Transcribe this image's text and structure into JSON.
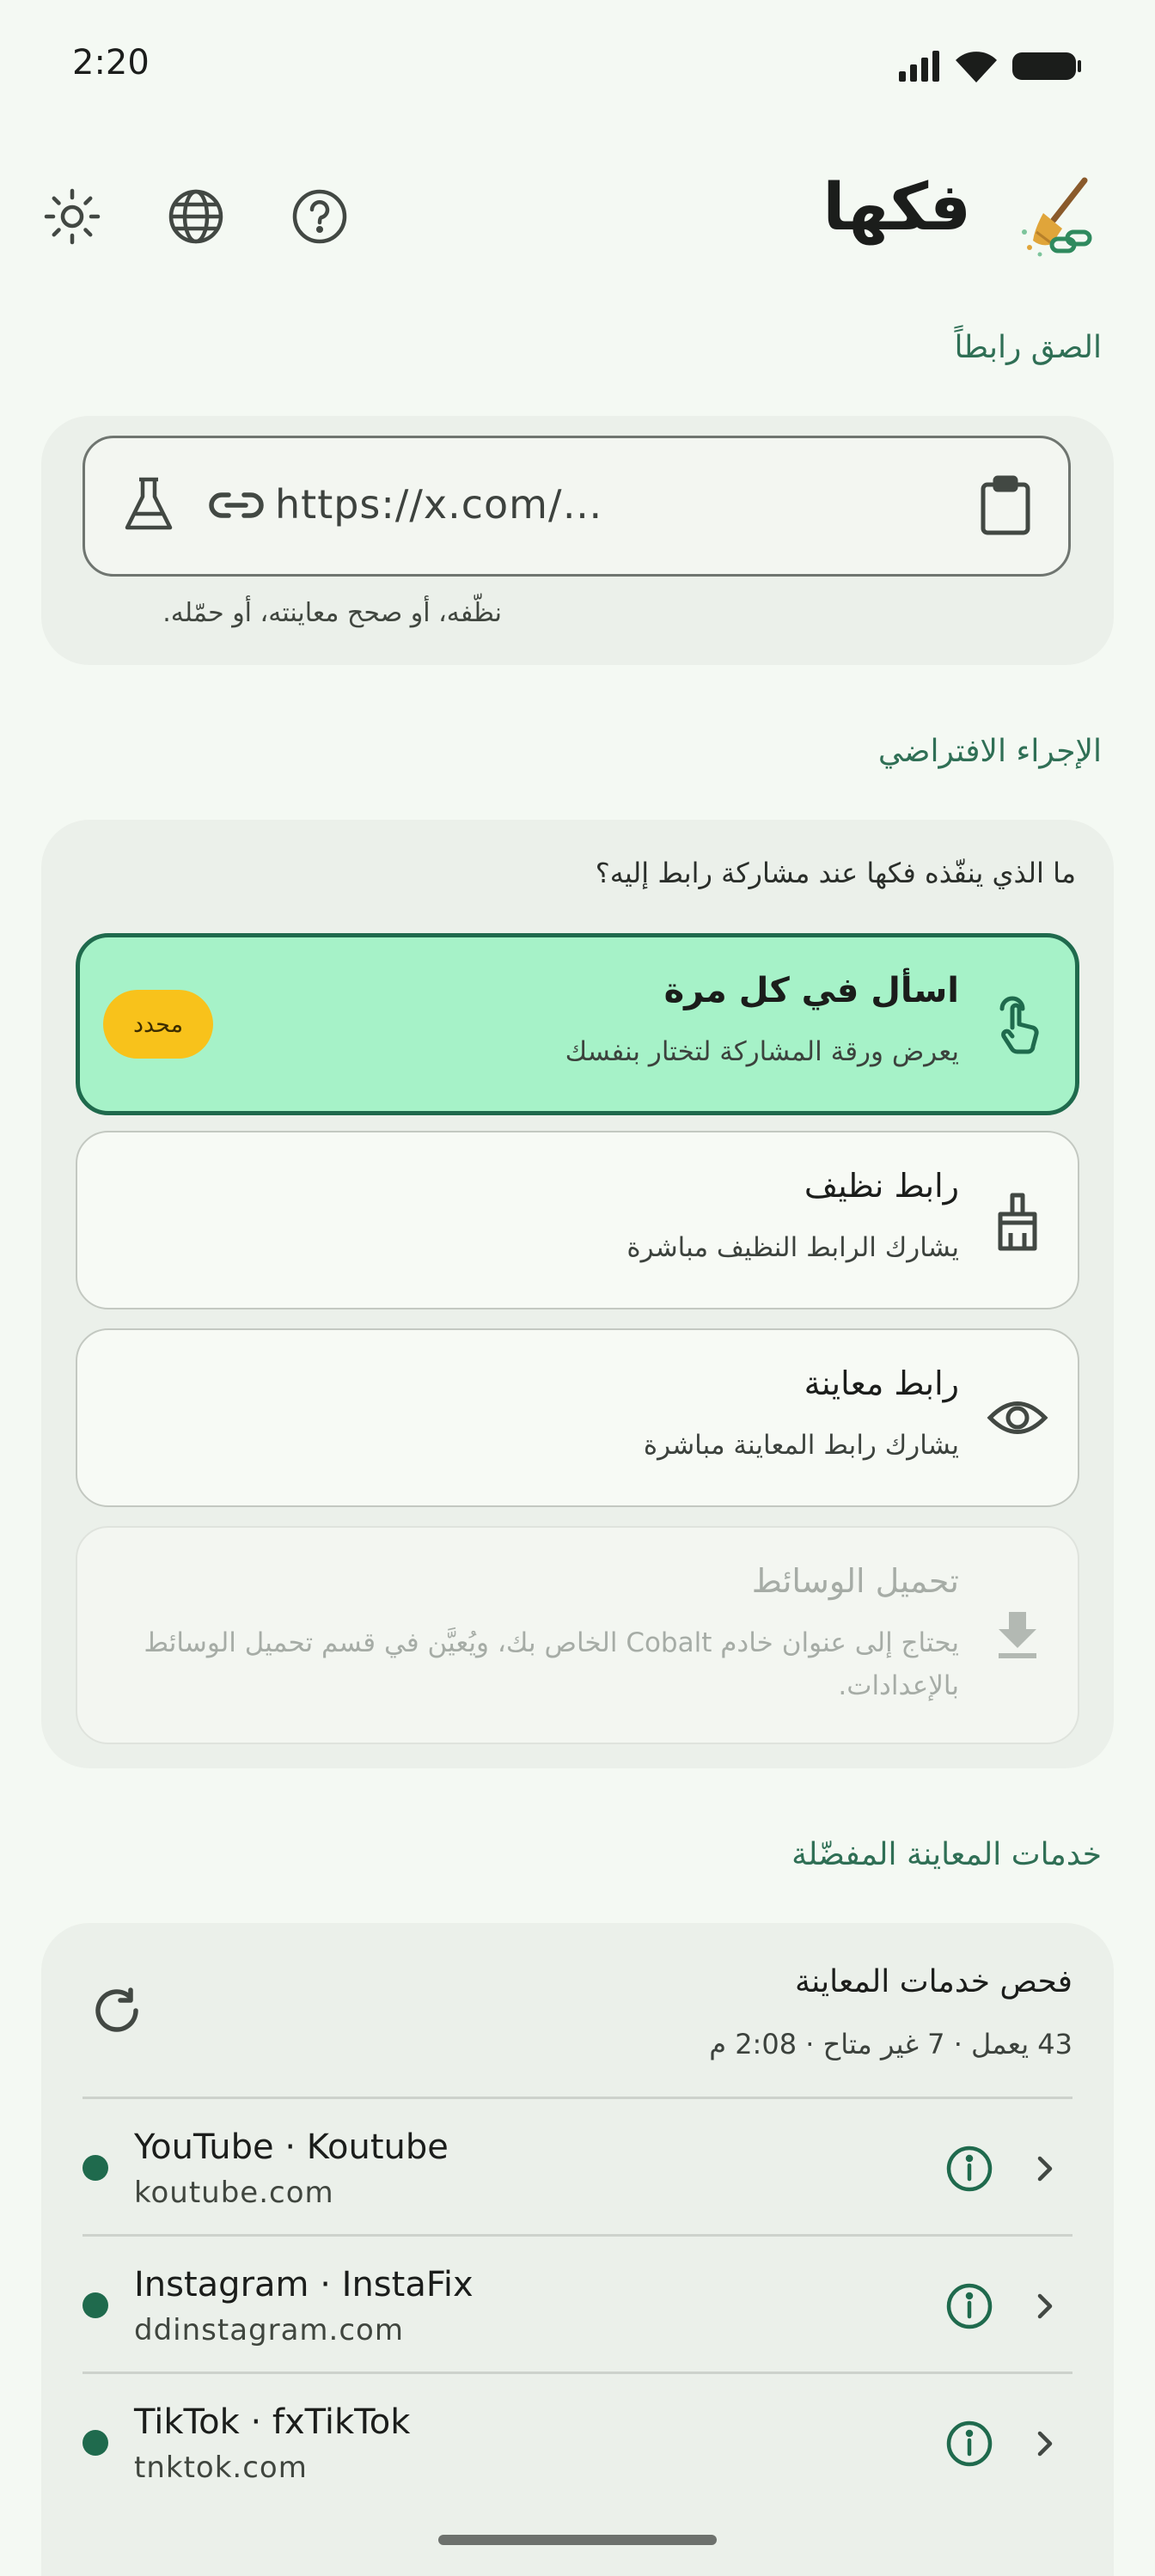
{
  "status_bar": {
    "time": "2:20",
    "icons": [
      "signal-icon",
      "wifi-icon",
      "battery-icon"
    ]
  },
  "header": {
    "app_title": "فكها",
    "logo_icon": "broom-link-logo",
    "actions": [
      "brightness-icon",
      "globe-icon",
      "help-icon"
    ]
  },
  "paste_section": {
    "label": "الصق رابطاً",
    "input_value": "https://x.com/…",
    "hint": "نظّفه، أو صحح معاينته، أو حمّله.",
    "icons": [
      "flask-icon",
      "link-icon",
      "clipboard-icon"
    ]
  },
  "default_action": {
    "label": "الإجراء الافتراضي",
    "prompt": "ما الذي ينفّذه فكها عند مشاركة رابط إليه؟",
    "selected_badge": "محدد",
    "options": [
      {
        "title": "اسأل في كل مرة",
        "desc": "يعرض ورقة المشاركة لتختار بنفسك",
        "icon": "tap-hand-icon",
        "selected": true
      },
      {
        "title": "رابط نظيف",
        "desc": "يشارك الرابط النظيف مباشرة",
        "icon": "broom-icon"
      },
      {
        "title": "رابط معاينة",
        "desc": "يشارك رابط المعاينة مباشرة",
        "icon": "eye-icon"
      },
      {
        "title": "تحميل الوسائط",
        "desc": "يحتاج إلى عنوان خادم Cobalt الخاص بك، ويُعيَّن في قسم تحميل الوسائط",
        "desc2": "بالإعدادات.",
        "icon": "download-icon",
        "disabled": true
      }
    ]
  },
  "services": {
    "label": "خدمات المعاينة المفضّلة",
    "check_title": "فحص خدمات المعاينة",
    "check_status": "43 يعمل · 7 غير متاح · 2:08 م",
    "items": [
      {
        "name": "YouTube · Koutube",
        "domain": "koutube.com",
        "status_color": "#1f6a4d"
      },
      {
        "name": "Instagram · InstaFix",
        "domain": "ddinstagram.com",
        "status_color": "#1f6a4d"
      },
      {
        "name": "TikTok · fxTikTok",
        "domain": "tnktok.com",
        "status_color": "#1f6a4d"
      }
    ]
  },
  "colors": {
    "accent": "#1f6a4d",
    "selected_bg": "#a6f2c8",
    "badge": "#f8c21b",
    "background": "#f4f9f3"
  }
}
